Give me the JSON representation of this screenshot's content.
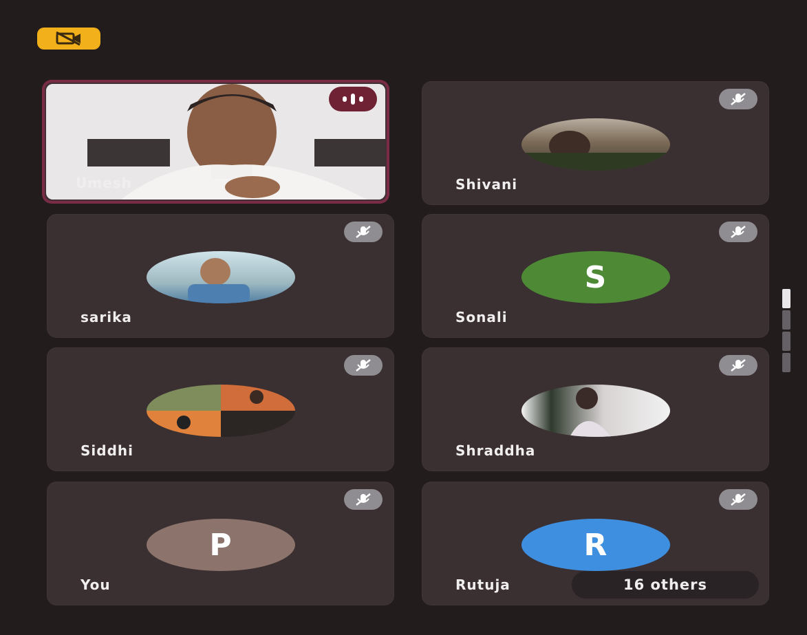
{
  "meeting": {
    "camera_off_icon": "camera-off-icon",
    "others_count_label": "16 others"
  },
  "tiles": [
    {
      "name": "Umesh",
      "type": "video",
      "speaking": true
    },
    {
      "name": "Shivani",
      "type": "photo"
    },
    {
      "name": "sarika",
      "type": "photo"
    },
    {
      "name": "Sonali",
      "type": "initial",
      "initial": "S",
      "avatar_color": "#4e8a36"
    },
    {
      "name": "Siddhi",
      "type": "photo"
    },
    {
      "name": "Shraddha",
      "type": "photo"
    },
    {
      "name": "You",
      "type": "initial",
      "initial": "P",
      "avatar_color": "#8c746c"
    },
    {
      "name": "Rutuja",
      "type": "initial",
      "initial": "R",
      "avatar_color": "#3f8fe0"
    }
  ],
  "pager": {
    "pages": 4,
    "current": 1
  },
  "colors": {
    "accent_badge": "#f2b01a",
    "speaking_border": "#7a2b45",
    "tile_bg": "#3a2f31",
    "mute_badge": "#8f8d91"
  }
}
